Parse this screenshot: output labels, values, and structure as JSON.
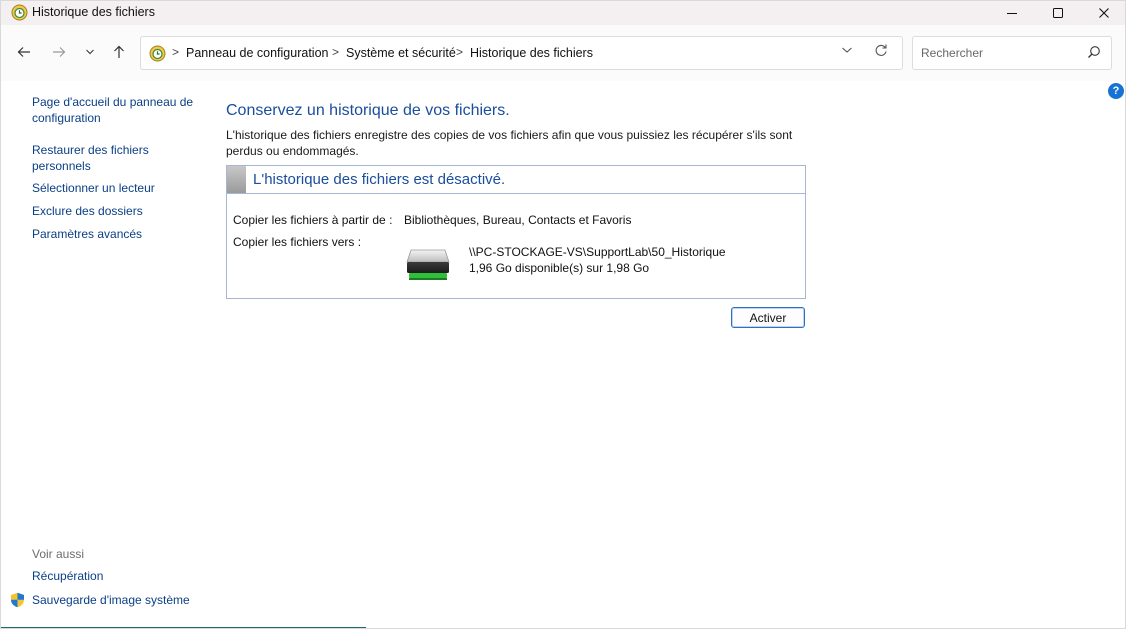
{
  "window": {
    "title": "Historique des fichiers",
    "icon": "file-history-icon",
    "controls": [
      "minimize-icon",
      "maximize-icon",
      "close-icon"
    ]
  },
  "nav": {
    "icons": [
      "back-arrow-icon",
      "forward-arrow-icon",
      "chevron-down-icon",
      "up-arrow-icon"
    ]
  },
  "address": {
    "breadcrumbs": [
      "Panneau de configuration",
      "Système et sécurité",
      "Historique des fichiers"
    ],
    "separator": ">",
    "icons": [
      "control-panel-icon",
      "chevron-down-icon",
      "refresh-icon"
    ]
  },
  "search": {
    "placeholder": "Rechercher",
    "value": ""
  },
  "help": {
    "label": "?"
  },
  "sidebar": {
    "links": [
      "Page d'accueil du panneau de configuration",
      "Restaurer des fichiers personnels",
      "Sélectionner un lecteur",
      "Exclure des dossiers",
      "Paramètres avancés"
    ],
    "see_also_label": "Voir aussi",
    "see_also_links": [
      "Récupération",
      "Sauvegarde d'image système"
    ]
  },
  "main": {
    "title": "Conservez un historique de vos fichiers.",
    "description": "L'historique des fichiers enregistre des copies de vos fichiers afin que vous puissiez les récupérer s'ils sont perdus ou endommagés.",
    "status": "L'historique des fichiers est désactivé.",
    "copy_from_label": "Copier les fichiers à partir de :",
    "copy_from_value": "Bibliothèques, Bureau, Contacts et Favoris",
    "copy_to_label": "Copier les fichiers vers :",
    "drive_path": "\\\\PC-STOCKAGE-VS\\SupportLab\\50_Historique",
    "drive_space": "1,96 Go disponible(s) sur 1,98 Go",
    "activate_button": "Activer"
  },
  "colors": {
    "link": "#0a3f86",
    "heading": "#1a4d9c",
    "panel_border": "#a5b7d3",
    "drive_led": "#2fbf3a"
  }
}
